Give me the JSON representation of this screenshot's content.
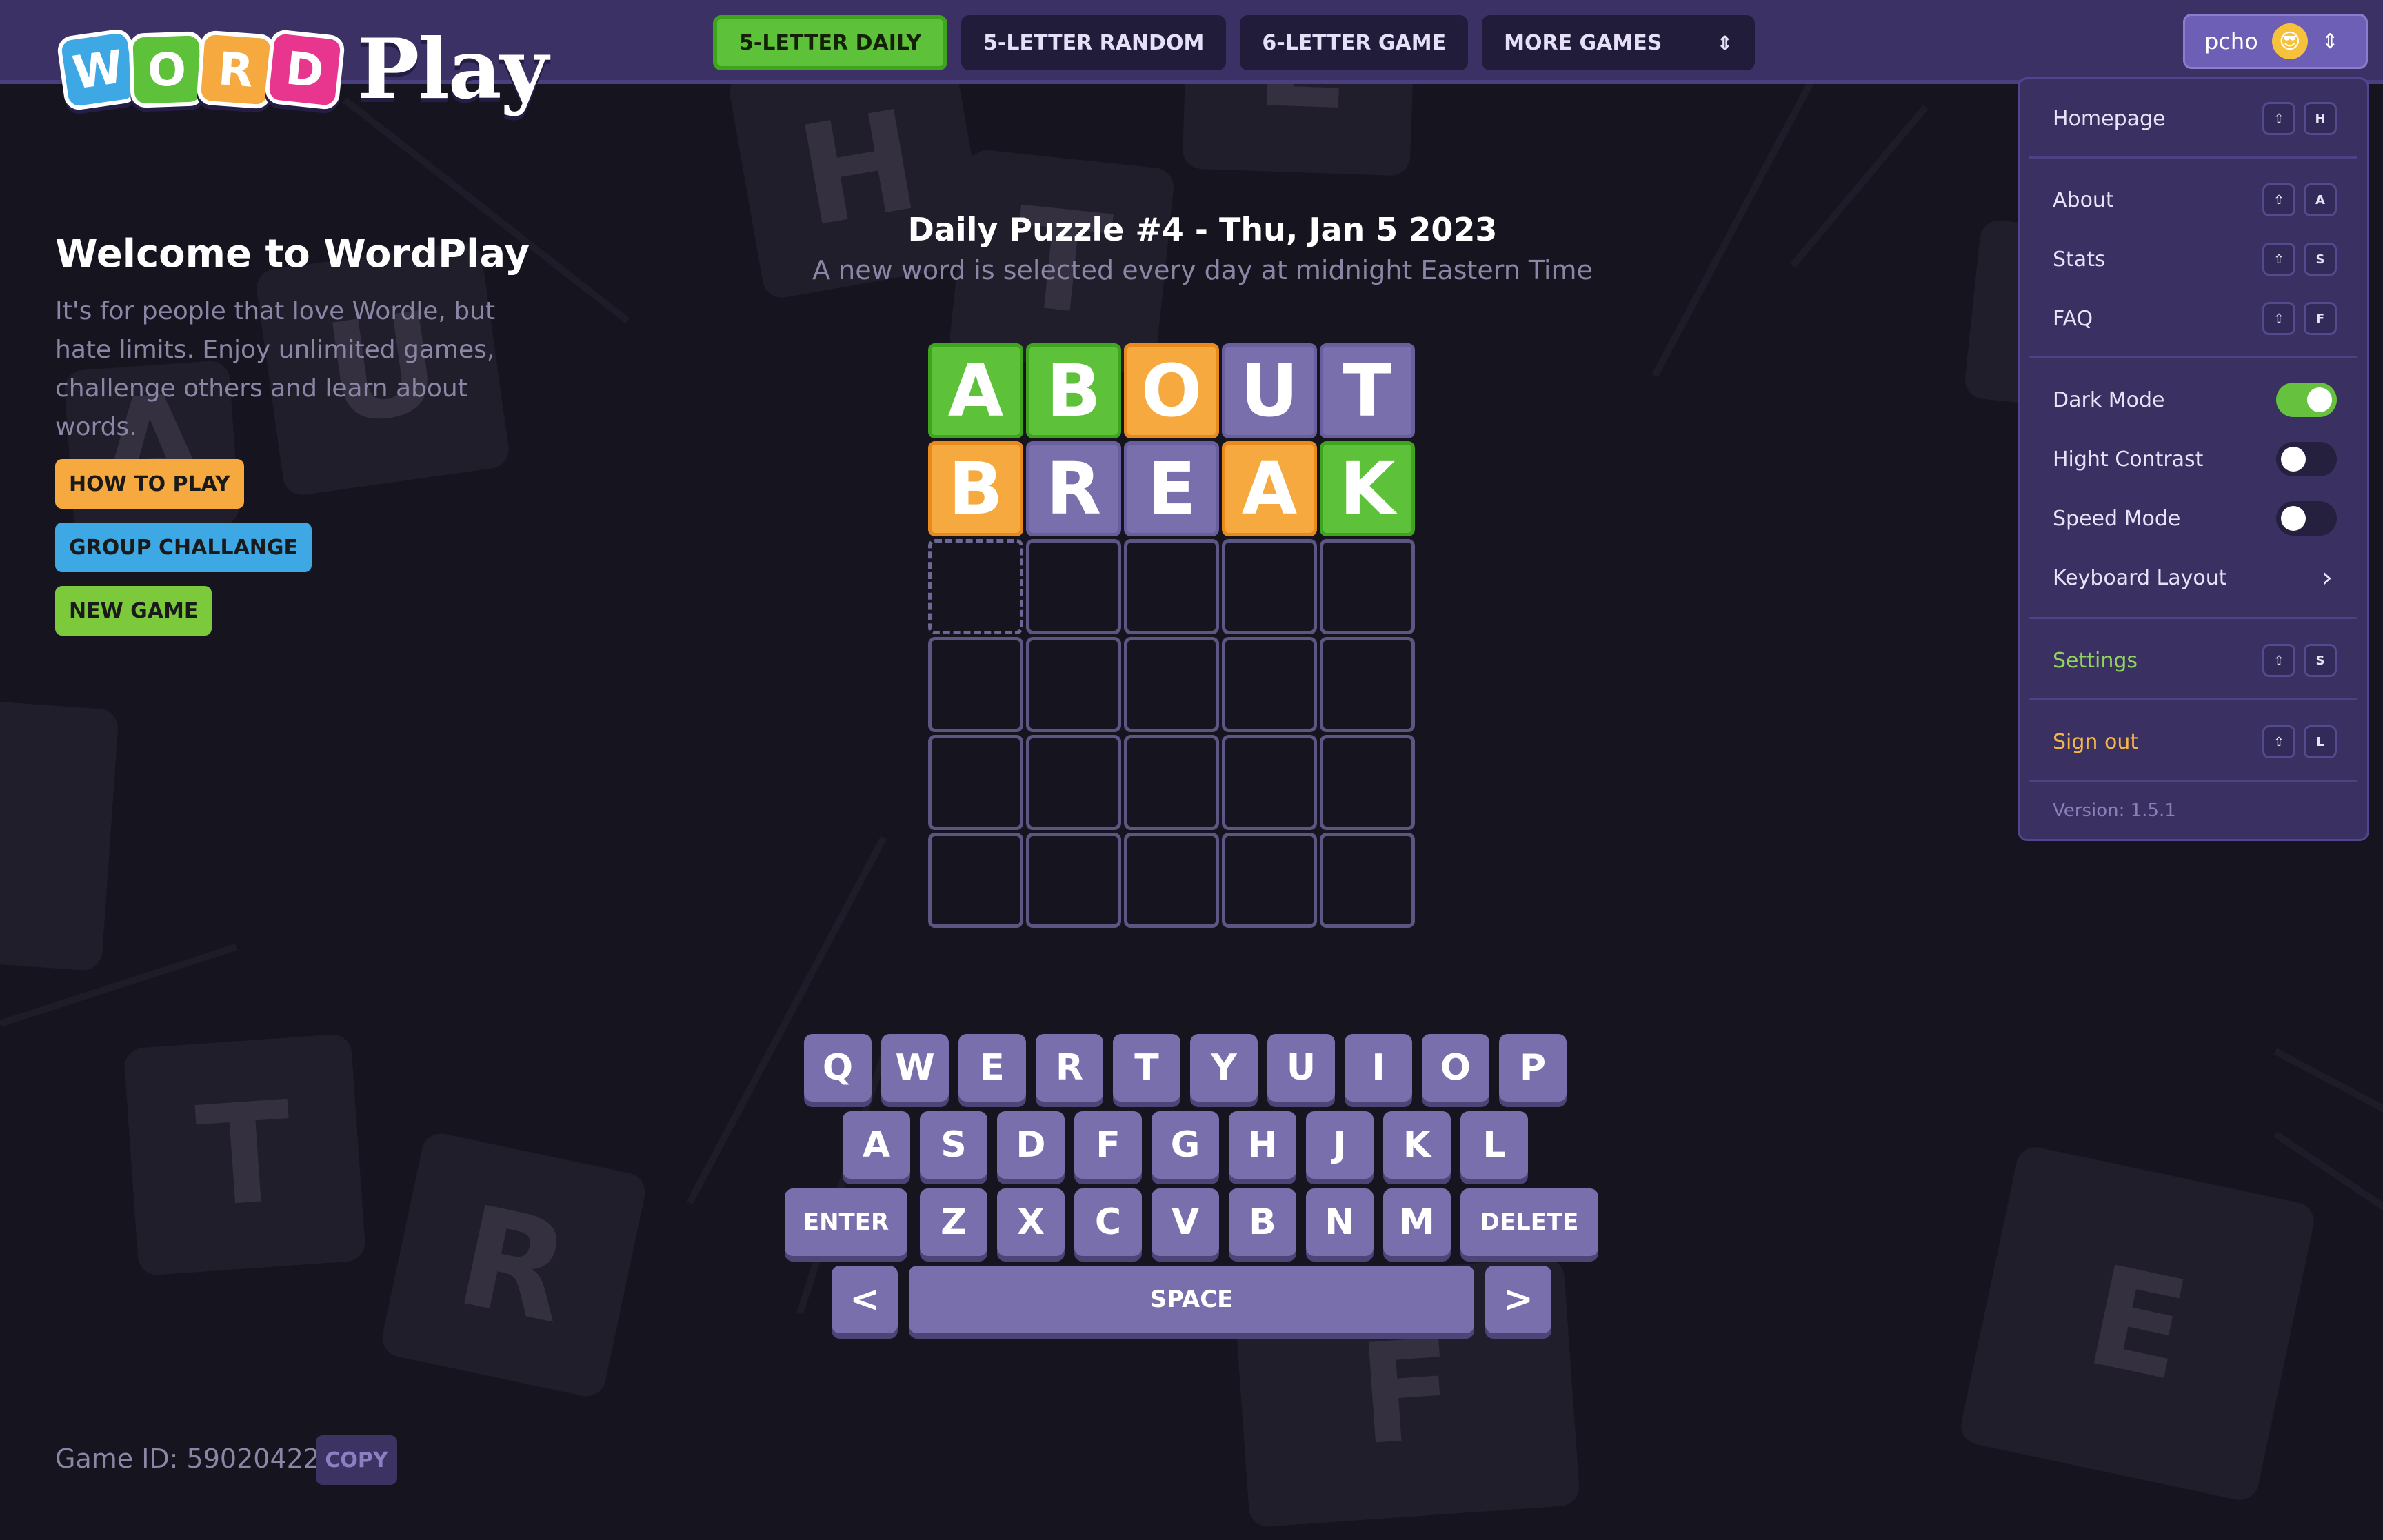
{
  "app": {
    "logo_letters": [
      "W",
      "O",
      "R",
      "D"
    ],
    "logo_colors": [
      "#3ea8e5",
      "#5ec13a",
      "#f5a93e",
      "#e8368f"
    ],
    "logo_word": "Play"
  },
  "nav": {
    "daily": "5-LETTER DAILY",
    "random": "5-LETTER RANDOM",
    "six": "6-LETTER GAME",
    "more": "MORE GAMES",
    "more_icon": "⌃⌄"
  },
  "user": {
    "name": "pcho",
    "avatar_icon": "😎",
    "chevron": "⇕"
  },
  "menu": {
    "homepage": {
      "label": "Homepage",
      "keys": [
        "⇧",
        "H"
      ]
    },
    "about": {
      "label": "About",
      "keys": [
        "⇧",
        "A"
      ]
    },
    "stats": {
      "label": "Stats",
      "keys": [
        "⇧",
        "S"
      ]
    },
    "faq": {
      "label": "FAQ",
      "keys": [
        "⇧",
        "F"
      ]
    },
    "dark_mode": {
      "label": "Dark Mode",
      "on": true
    },
    "high_contrast": {
      "label": "Hight Contrast",
      "on": false
    },
    "speed_mode": {
      "label": "Speed Mode",
      "on": false
    },
    "keyboard_layout": {
      "label": "Keyboard Layout",
      "chevron": "›"
    },
    "settings": {
      "label": "Settings",
      "keys": [
        "⇧",
        "S"
      ]
    },
    "signout": {
      "label": "Sign out",
      "keys": [
        "⇧",
        "L"
      ]
    },
    "version": "Version: 1.5.1"
  },
  "welcome": {
    "title": "Welcome to WordPlay",
    "text": "It's for people that love Wordle, but hate limits. Enjoy unlimited games, challenge others and learn about words."
  },
  "buttons": {
    "how_to_play": "HOW TO PLAY",
    "group_challenge": "GROUP CHALLANGE",
    "new_game": "NEW GAME"
  },
  "colors": {
    "how_to_play": "#f5a93e",
    "group_challenge": "#3ea8e5",
    "new_game": "#7cc93c"
  },
  "puzzle": {
    "title": "Daily Puzzle #4 - Thu, Jan 5 2023",
    "subtitle": "A new word is selected every day at midnight Eastern Time"
  },
  "board": {
    "rows": [
      [
        {
          "l": "A",
          "s": "correct"
        },
        {
          "l": "B",
          "s": "correct"
        },
        {
          "l": "O",
          "s": "present"
        },
        {
          "l": "U",
          "s": "absent"
        },
        {
          "l": "T",
          "s": "absent"
        }
      ],
      [
        {
          "l": "B",
          "s": "present"
        },
        {
          "l": "R",
          "s": "absent"
        },
        {
          "l": "E",
          "s": "absent"
        },
        {
          "l": "A",
          "s": "present"
        },
        {
          "l": "K",
          "s": "correct"
        }
      ],
      [
        {
          "l": "",
          "s": "current"
        },
        {
          "l": "",
          "s": "empty"
        },
        {
          "l": "",
          "s": "empty"
        },
        {
          "l": "",
          "s": "empty"
        },
        {
          "l": "",
          "s": "empty"
        }
      ],
      [
        {
          "l": "",
          "s": "empty"
        },
        {
          "l": "",
          "s": "empty"
        },
        {
          "l": "",
          "s": "empty"
        },
        {
          "l": "",
          "s": "empty"
        },
        {
          "l": "",
          "s": "empty"
        }
      ],
      [
        {
          "l": "",
          "s": "empty"
        },
        {
          "l": "",
          "s": "empty"
        },
        {
          "l": "",
          "s": "empty"
        },
        {
          "l": "",
          "s": "empty"
        },
        {
          "l": "",
          "s": "empty"
        }
      ],
      [
        {
          "l": "",
          "s": "empty"
        },
        {
          "l": "",
          "s": "empty"
        },
        {
          "l": "",
          "s": "empty"
        },
        {
          "l": "",
          "s": "empty"
        },
        {
          "l": "",
          "s": "empty"
        }
      ]
    ]
  },
  "keyboard": {
    "row1": [
      "Q",
      "W",
      "E",
      "R",
      "T",
      "Y",
      "U",
      "I",
      "O",
      "P"
    ],
    "row2": [
      "A",
      "S",
      "D",
      "F",
      "G",
      "H",
      "J",
      "K",
      "L"
    ],
    "row3": [
      "ENTER",
      "Z",
      "X",
      "C",
      "V",
      "B",
      "N",
      "M",
      "DELETE"
    ],
    "row4": [
      "<",
      "SPACE",
      ">"
    ]
  },
  "footer": {
    "game_id": "Game ID: 590204223",
    "copy": "COPY"
  },
  "background_letters": [
    "H",
    "L",
    "T",
    "U",
    "A",
    "T",
    "R",
    "F",
    "E"
  ]
}
